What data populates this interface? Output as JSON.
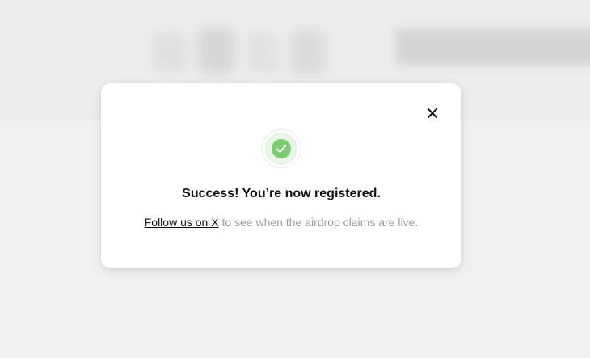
{
  "modal": {
    "title": "Success! You’re now registered.",
    "link_text": "Follow us on X",
    "message_rest": " to see when the airdrop claims are live.",
    "close_icon": "close-icon",
    "status_icon": "check-circle-icon"
  },
  "colors": {
    "success_green": "#7ccd6f",
    "success_ring": "#e6f5e3",
    "backdrop": "#efefef",
    "muted_text": "#9a9a9a"
  }
}
